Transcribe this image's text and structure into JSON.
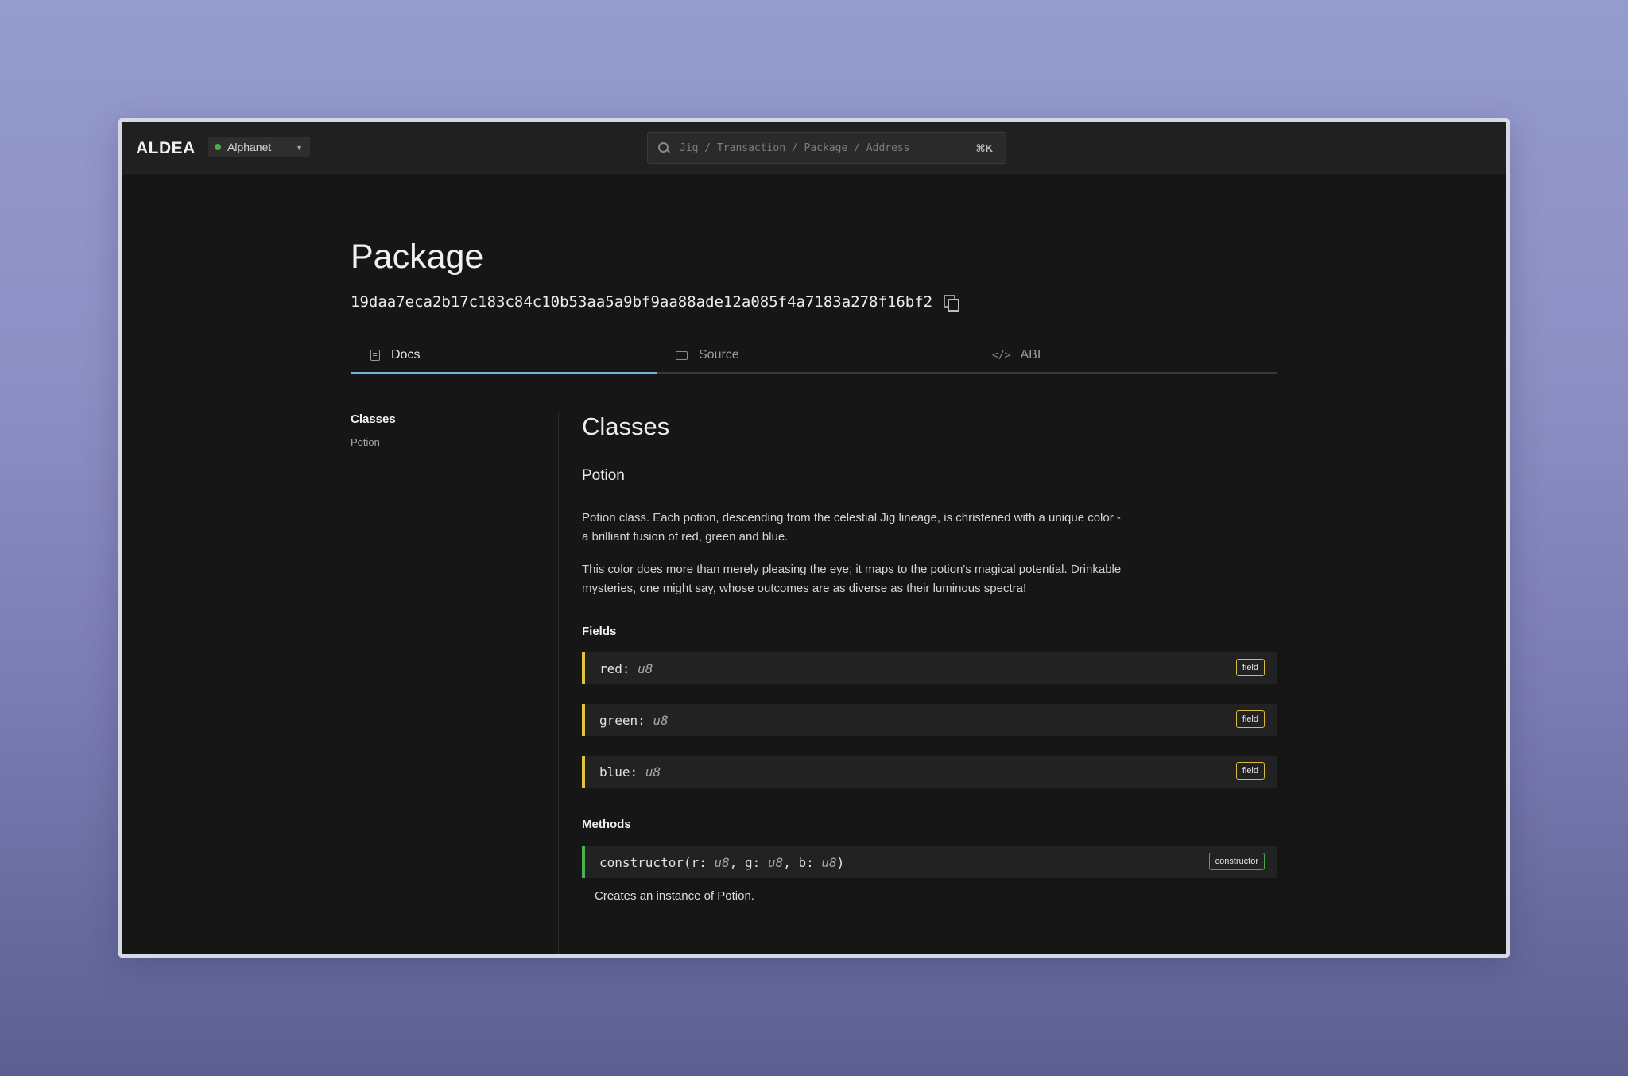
{
  "header": {
    "logo": "ALDEA",
    "network": "Alphanet",
    "search_placeholder": "Jig / Transaction / Package / Address",
    "shortcut": "⌘K"
  },
  "page": {
    "title": "Package",
    "hash": "19daa7eca2b17c183c84c10b53aa5a9bf9aa88ade12a085f4a7183a278f16bf2"
  },
  "tabs": [
    {
      "label": "Docs",
      "active": true
    },
    {
      "label": "Source",
      "active": false
    },
    {
      "label": "ABI",
      "active": false
    }
  ],
  "sidebar": {
    "title": "Classes",
    "items": [
      {
        "label": "Potion"
      }
    ]
  },
  "content": {
    "heading": "Classes",
    "class_name": "Potion",
    "paragraphs": [
      "Potion class. Each potion, descending from the celestial Jig lineage, is christened with a unique color - a brilliant fusion of red, green and blue.",
      "This color does more than merely pleasing the eye; it maps to the potion's magical potential. Drinkable mysteries, one might say, whose outcomes are as diverse as their luminous spectra!"
    ],
    "fields_label": "Fields",
    "fields": [
      {
        "name": "red:",
        "type": "u8",
        "badge": "field"
      },
      {
        "name": "green:",
        "type": "u8",
        "badge": "field"
      },
      {
        "name": "blue:",
        "type": "u8",
        "badge": "field"
      }
    ],
    "methods_label": "Methods",
    "methods": [
      {
        "name": "constructor",
        "params": [
          {
            "name": "r:",
            "type": "u8"
          },
          {
            "name": "g:",
            "type": "u8"
          },
          {
            "name": "b:",
            "type": "u8"
          }
        ],
        "badge": "constructor",
        "description": "Creates an instance of Potion."
      }
    ]
  },
  "colors": {
    "field_accent": "#e0c240",
    "method_accent": "#4caf50",
    "tab_active": "#6fb6d9",
    "network_status": "#4caf50"
  }
}
